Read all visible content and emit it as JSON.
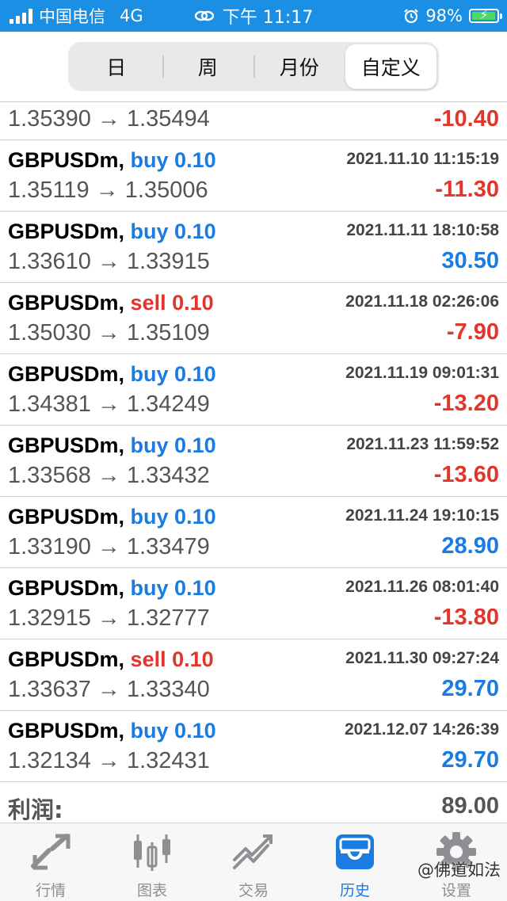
{
  "status_bar": {
    "carrier": "中国电信",
    "network": "4G",
    "time": "下午 11:17",
    "battery": "98%"
  },
  "tabs": [
    {
      "label": "日",
      "active": false
    },
    {
      "label": "周",
      "active": false
    },
    {
      "label": "月份",
      "active": false
    },
    {
      "label": "自定义",
      "active": true
    }
  ],
  "partial_row": {
    "prices": "1.35390 → 1.35494",
    "profit": "-10.40"
  },
  "trades": [
    {
      "symbol": "GBPUSDm,",
      "side": "buy 0.10",
      "side_type": "buy",
      "time": "2021.11.10 11:15:19",
      "prices": "1.35119 → 1.35006",
      "profit": "-11.30"
    },
    {
      "symbol": "GBPUSDm,",
      "side": "buy 0.10",
      "side_type": "buy",
      "time": "2021.11.11 18:10:58",
      "prices": "1.33610 → 1.33915",
      "profit": "30.50"
    },
    {
      "symbol": "GBPUSDm,",
      "side": "sell 0.10",
      "side_type": "sell",
      "time": "2021.11.18 02:26:06",
      "prices": "1.35030 → 1.35109",
      "profit": "-7.90"
    },
    {
      "symbol": "GBPUSDm,",
      "side": "buy 0.10",
      "side_type": "buy",
      "time": "2021.11.19 09:01:31",
      "prices": "1.34381 → 1.34249",
      "profit": "-13.20"
    },
    {
      "symbol": "GBPUSDm,",
      "side": "buy 0.10",
      "side_type": "buy",
      "time": "2021.11.23 11:59:52",
      "prices": "1.33568 → 1.33432",
      "profit": "-13.60"
    },
    {
      "symbol": "GBPUSDm,",
      "side": "buy 0.10",
      "side_type": "buy",
      "time": "2021.11.24 19:10:15",
      "prices": "1.33190 → 1.33479",
      "profit": "28.90"
    },
    {
      "symbol": "GBPUSDm,",
      "side": "buy 0.10",
      "side_type": "buy",
      "time": "2021.11.26 08:01:40",
      "prices": "1.32915 → 1.32777",
      "profit": "-13.80"
    },
    {
      "symbol": "GBPUSDm,",
      "side": "sell 0.10",
      "side_type": "sell",
      "time": "2021.11.30 09:27:24",
      "prices": "1.33637 → 1.33340",
      "profit": "29.70"
    },
    {
      "symbol": "GBPUSDm,",
      "side": "buy 0.10",
      "side_type": "buy",
      "time": "2021.12.07 14:26:39",
      "prices": "1.32134 → 1.32431",
      "profit": "29.70"
    }
  ],
  "total": {
    "label": "利润:",
    "value": "89.00"
  },
  "bottom_nav": [
    {
      "label": "行情",
      "icon": "quotes-arrows-icon",
      "active": false
    },
    {
      "label": "图表",
      "icon": "chart-candles-icon",
      "active": false
    },
    {
      "label": "交易",
      "icon": "trade-chart-icon",
      "active": false
    },
    {
      "label": "历史",
      "icon": "history-inbox-icon",
      "active": true
    },
    {
      "label": "设置",
      "icon": "gear-icon",
      "active": false
    }
  ],
  "watermark": "@佛道如法",
  "colors": {
    "accent": "#1a7be0",
    "negative": "#e0362b",
    "status_bar": "#1a8fe3"
  }
}
